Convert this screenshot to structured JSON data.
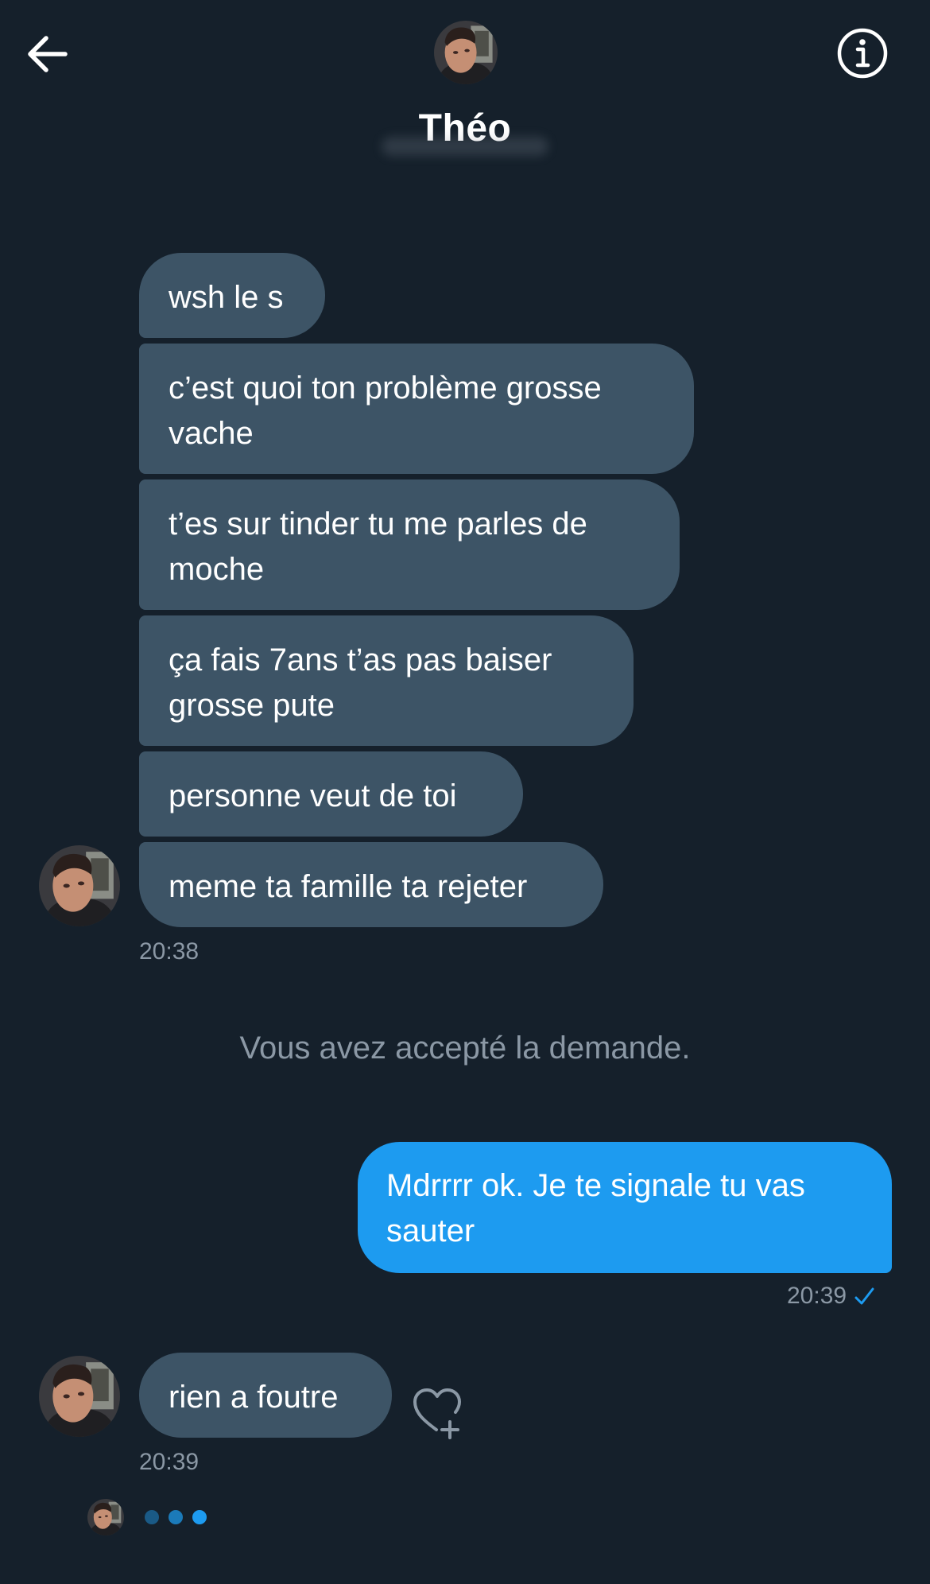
{
  "header": {
    "back_icon": "arrow-left-icon",
    "info_icon": "info-circle-icon",
    "contact_name": "Théo",
    "avatar_icon": "contact-avatar"
  },
  "messages": {
    "incoming_group_1": [
      "wsh le s",
      "c’est quoi ton problème grosse vache",
      "t’es sur tinder tu me parles de moche",
      "ça fais 7ans t’as pas baiser grosse pute",
      "personne veut de toi",
      "meme ta famille ta rejeter"
    ],
    "incoming_group_1_time": "20:38",
    "system_notice": "Vous avez accepté la demande.",
    "outgoing": "Mdrrrr ok. Je te signale tu vas sauter",
    "outgoing_time": "20:39",
    "outgoing_status_icon": "check-icon",
    "incoming_group_2": [
      "rien a foutre"
    ],
    "incoming_group_2_time": "20:39",
    "reaction_icon": "heart-plus-icon",
    "typing_indicator_icon": "typing-dots-icon"
  },
  "colors": {
    "background": "#15202B",
    "incoming_bubble": "#3D5466",
    "outgoing_bubble": "#1D9BF0",
    "secondary_text": "#8B98A5",
    "accent": "#1D9BF0"
  }
}
